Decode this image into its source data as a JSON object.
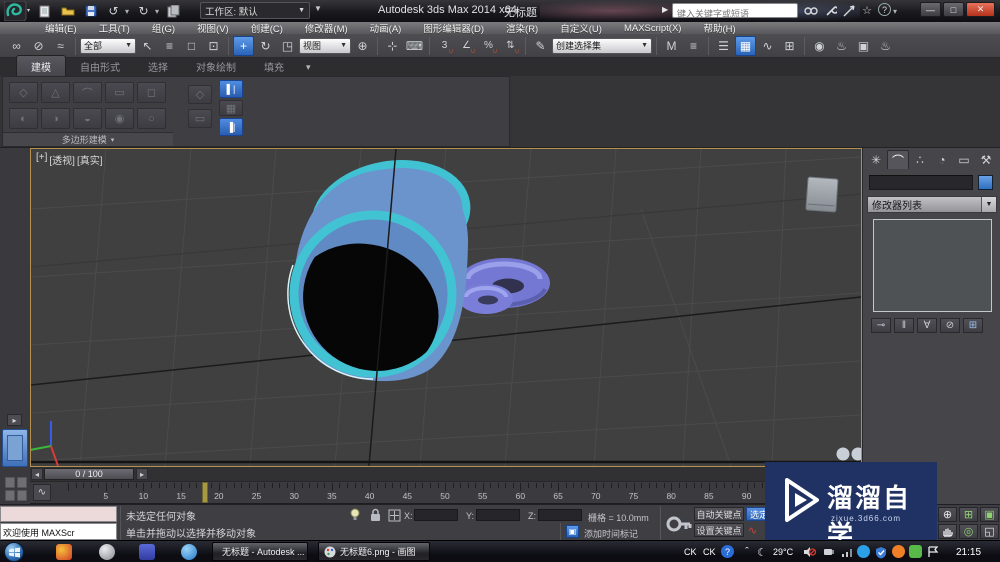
{
  "title_bar": {
    "workspace": "工作区: 默认",
    "app_title": "Autodesk 3ds Max  2014 x64",
    "doc_title": "无标题",
    "search_placeholder": "键入关键字或短语"
  },
  "menu_bar": {
    "items": [
      "编辑(E)",
      "工具(T)",
      "组(G)",
      "视图(V)",
      "创建(C)",
      "修改器(M)",
      "动画(A)",
      "图形编辑器(D)",
      "渲染(R)",
      "自定义(U)",
      "MAXScript(X)",
      "帮助(H)"
    ]
  },
  "toolbar": {
    "selection_filter": "全部",
    "ref_coord": "视图",
    "named_sets": "创建选择集"
  },
  "ribbon": {
    "tabs": [
      "建模",
      "自由形式",
      "选择",
      "对象绘制",
      "填充"
    ],
    "footer": "多边形建模"
  },
  "viewport": {
    "label_general": "[+]",
    "label_pov": "[透视]",
    "label_shading": "[真实]"
  },
  "command_panel": {
    "modifier_list": "修改器列表"
  },
  "timeline": {
    "frame_display": "0 / 100",
    "tick_labels": [
      "5",
      "10",
      "15",
      "20",
      "25",
      "30",
      "35",
      "40",
      "45",
      "50",
      "55",
      "60",
      "65",
      "70",
      "75",
      "80",
      "85",
      "90"
    ]
  },
  "status_bar": {
    "listener_text": "欢迎使用 MAXScr",
    "prompt_line1": "未选定任何对象",
    "prompt_line2": "单击并拖动以选择并移动对象",
    "x_label": "X:",
    "y_label": "Y:",
    "z_label": "Z:",
    "grid_value": "栅格 = 10.0mm",
    "add_time_tag": "添加时间标记",
    "auto_key": "自动关键点",
    "set_key": "设置关键点",
    "selected_filter": "选定"
  },
  "watermark": {
    "title": "溜溜自学",
    "subtitle": "zixue.3d66.com"
  },
  "taskbar": {
    "task1": "无标题 - Autodesk ...",
    "task2": "无标题6.png - 画图",
    "tray": {
      "ime1": "CK",
      "ime2": "CK",
      "temperature": "29°C",
      "clock": "21:15"
    }
  },
  "colors": {
    "accent_blue": "#2f6fc0",
    "viewport_border": "#b5914f",
    "watermark_bg": "#1f3263",
    "tube_rim": "#42c3d3",
    "tube_body": "#6b94cd",
    "torus_purple": "#7478d2"
  },
  "icons": {
    "undo": "↺",
    "redo": "↻",
    "menu_caret": "▾",
    "dropdown_caret": "▼",
    "title_play": "▶",
    "star": "☆",
    "help": "?",
    "win_min": "—",
    "win_max": "□",
    "win_close": "✕",
    "select_link": "∞",
    "unlink": "⊘",
    "bind_spacewarp": "≈",
    "select_arrow": "↖",
    "select_by_name": "≡",
    "region_rect": "□",
    "window_crossing": "⊡",
    "move": "+",
    "rotate": "↻",
    "scale": "◳",
    "use_center": "⊕",
    "manipulate": "⊹",
    "kbd_override": "⌨",
    "snap_3": "3",
    "snap_angle": "∠",
    "snap_percent": "%",
    "snap_spinner": "⇅",
    "magnet": "∩",
    "edit_sets": "✎",
    "mirror": "M",
    "align": "≡",
    "layers": "☰",
    "graphite": "▦",
    "curve_editor": "∿",
    "schematic": "⊞",
    "material": "◉",
    "render_setup": "♨",
    "render_frame": "▣",
    "render": "♨",
    "cp_create": "✳",
    "cp_modify": "⌒",
    "cp_hierarchy": "∴",
    "cp_motion": "◔",
    "cp_display": "▭",
    "cp_utilities": "⚒",
    "pin_stack": "⊸",
    "show_end": "‖",
    "make_unique": "∀",
    "remove_modifier": "⊘",
    "configure_sets": "⊞",
    "prev_frame": "◂",
    "next_frame": "▸",
    "mini_curve": "∿",
    "play_flyout": "▸",
    "nav_zoom": "⊕",
    "nav_zoom_all": "⊞",
    "nav_zoom_extents": "▣",
    "nav_orbit": "◎",
    "nav_maximize": "◱",
    "tray_help": "?",
    "tray_caret": "ˆ",
    "tray_moon": "☾",
    "addtag_icon": "▣",
    "poly_btn1": "▌|",
    "poly_btn2": "▦",
    "poly_btn3": "▐|",
    "rib_r1_1": "◇",
    "rib_r1_2": "△",
    "rib_r1_3": "⌒",
    "rib_r1_4": "▭",
    "rib_r1_5": "◻",
    "rib_r2_1": "◐",
    "rib_r2_2": "◑",
    "rib_r2_3": "◒",
    "rib_r2_4": "◉",
    "rib_r2_5": "○",
    "rib_m1": "◇",
    "rib_m2": "▭"
  }
}
